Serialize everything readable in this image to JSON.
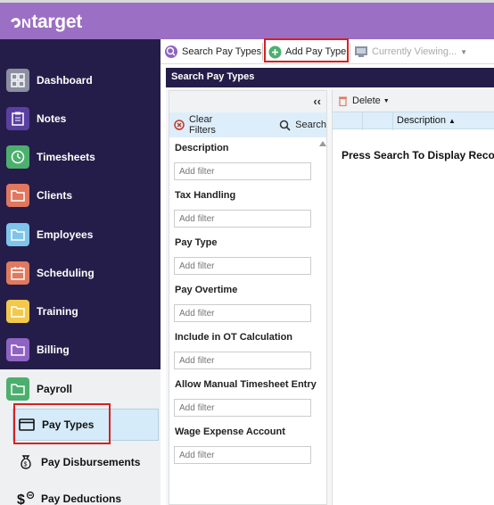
{
  "app": {
    "logo_prefix": "N",
    "logo_text": "target",
    "brand_color": "#9b6fc4",
    "nav_bg": "#251d49"
  },
  "sidebar": {
    "items": [
      {
        "label": "Dashboard",
        "icon": "dashboard-grid-icon",
        "color": "#8c8fa0"
      },
      {
        "label": "Notes",
        "icon": "clipboard-icon",
        "color": "#5a3fa3"
      },
      {
        "label": "Timesheets",
        "icon": "clock-icon",
        "color": "#4caf6e"
      },
      {
        "label": "Clients",
        "icon": "folder-icon",
        "color": "#e0775e"
      },
      {
        "label": "Employees",
        "icon": "folder-icon",
        "color": "#7fc4ea"
      },
      {
        "label": "Scheduling",
        "icon": "calendar-icon",
        "color": "#e07a5e"
      },
      {
        "label": "Training",
        "icon": "folder-icon",
        "color": "#f2c94c"
      },
      {
        "label": "Billing",
        "icon": "folder-icon",
        "color": "#8e63c2"
      },
      {
        "label": "Payroll",
        "icon": "folder-icon",
        "color": "#4caf6e"
      }
    ],
    "sub_items": [
      {
        "label": "Pay Types",
        "icon": "card-icon"
      },
      {
        "label": "Pay Disbursements",
        "icon": "money-bag-icon"
      },
      {
        "label": "Pay Deductions",
        "icon": "dollar-minus-icon"
      }
    ]
  },
  "toolbar": {
    "search_label": "Search Pay Types",
    "add_label": "Add Pay Type",
    "viewing_label": "Currently Viewing..."
  },
  "panel": {
    "title": "Search Pay Types"
  },
  "filters": {
    "clear_label": "Clear Filters",
    "search_label": "Search",
    "placeholder": "Add filter",
    "fields": [
      "Description",
      "Tax Handling",
      "Pay Type",
      "Pay Overtime",
      "Include in OT Calculation",
      "Allow Manual Timesheet Entry",
      "Wage Expense Account"
    ]
  },
  "results": {
    "delete_label": "Delete",
    "column_header": "Description",
    "empty_message": "Press Search To Display Records"
  }
}
